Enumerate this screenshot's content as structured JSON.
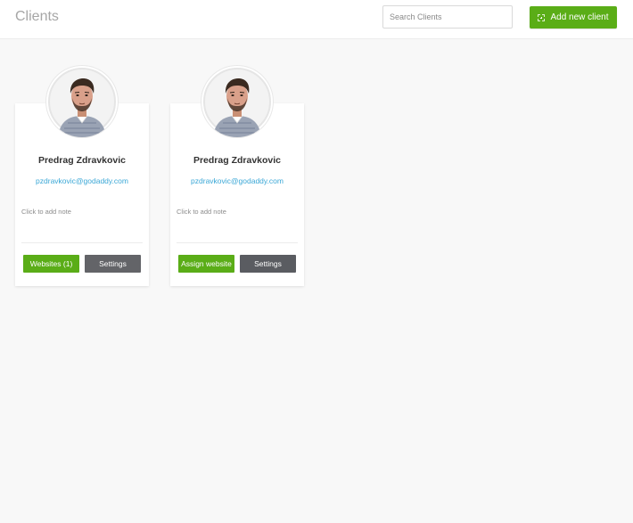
{
  "header": {
    "title": "Clients",
    "search_placeholder": "Search Clients",
    "add_button_label": "Add new client",
    "add_icon": "add-square-icon"
  },
  "colors": {
    "accent_green": "#5aad17",
    "dark_button": "#5a5c61",
    "email_link": "#3aa7d6",
    "background": "#f8f8f8"
  },
  "clients": [
    {
      "name": "Predrag Zdravkovic",
      "email": "pzdravkovic@godaddy.com",
      "note": "Click to add note",
      "primary_button": "Websites (1)",
      "settings_button": "Settings"
    },
    {
      "name": "Predrag Zdravkovic",
      "email": "pzdravkovic@godaddy.com",
      "note": "Click to add note",
      "primary_button": "Assign website",
      "settings_button": "Settings"
    }
  ]
}
